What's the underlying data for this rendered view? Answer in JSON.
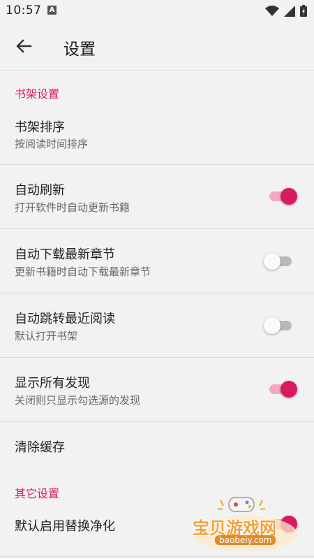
{
  "status_bar": {
    "time": "10:57",
    "notification_icon": "A"
  },
  "app_bar": {
    "title": "设置"
  },
  "sections": {
    "bookshelf": {
      "header": "书架设置"
    },
    "other": {
      "header": "其它设置"
    }
  },
  "prefs": {
    "sort": {
      "title": "书架排序",
      "summary": "按阅读时间排序"
    },
    "auto_refresh": {
      "title": "自动刷新",
      "summary": "打开软件时自动更新书籍",
      "checked": true
    },
    "auto_download": {
      "title": "自动下载最新章节",
      "summary": "更新书籍时自动下载最新章节",
      "checked": false
    },
    "auto_jump": {
      "title": "自动跳转最近阅读",
      "summary": "默认打开书架",
      "checked": false
    },
    "show_all_discover": {
      "title": "显示所有发现",
      "summary": "关闭则只显示勾选源的发现",
      "checked": true
    },
    "clear_cache": {
      "title": "清除缓存"
    },
    "replace_purify": {
      "title": "默认启用替换净化",
      "checked": true
    }
  },
  "watermark": {
    "text": "宝贝游戏网",
    "url": "baobeiy.com"
  },
  "colors": {
    "accent": "#d81b60",
    "background": "#f2f2f2"
  }
}
